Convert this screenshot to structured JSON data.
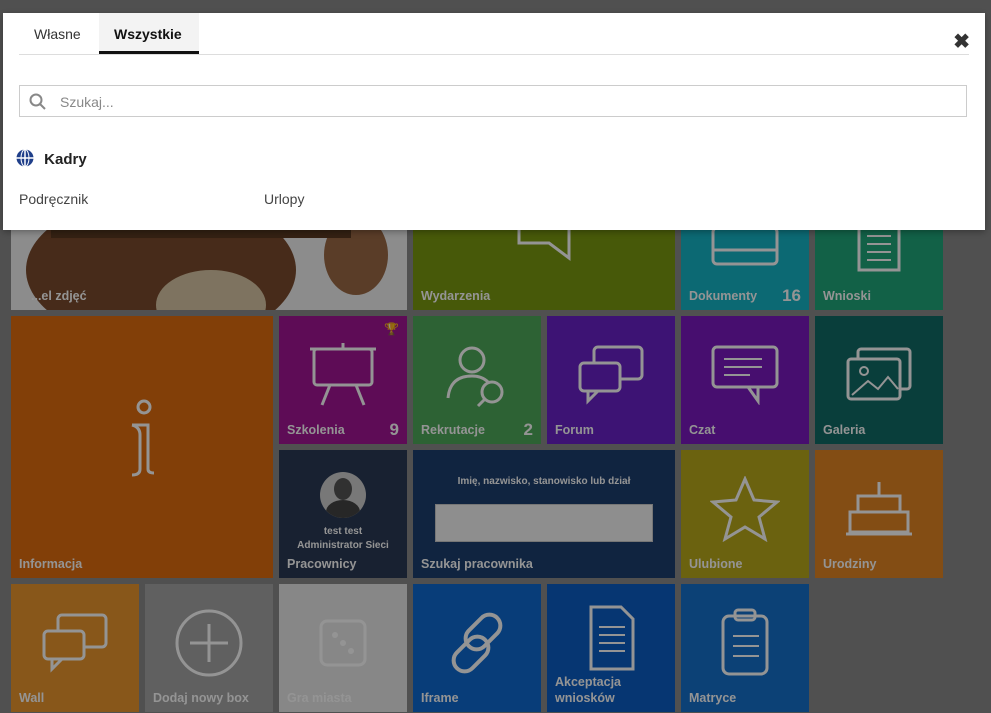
{
  "tiles": {
    "gallery": "...el zdjęć",
    "events": "Wydarzenia",
    "documents": "Dokumenty",
    "documents_count": "16",
    "requests": "Wnioski",
    "info": "Informacja",
    "trainings": "Szkolenia",
    "trainings_count": "9",
    "recruitment": "Rekrutacje",
    "recruitment_count": "2",
    "forum": "Forum",
    "chat": "Czat",
    "gallery2": "Galeria",
    "employees": "Pracownicy",
    "employee_name": "test test",
    "employee_role": "Administrator Sieci",
    "find_employee": "Szukaj pracownika",
    "find_employee_hint": "Imię, nazwisko, stanowisko lub dział",
    "favorites": "Ulubione",
    "birthdays": "Urodziny",
    "wall": "Wall",
    "add_box": "Dodaj nowy box",
    "city_game": "Gra miasta",
    "iframe": "Iframe",
    "approval_line1": "Akceptacja",
    "approval_line2": "wniosków",
    "matrices": "Matryce"
  },
  "colors": {
    "events": "#7b9a10",
    "documents": "#16b5c7",
    "requests": "#1fa77b",
    "info": "#e16d0e",
    "trainings": "#a21595",
    "recruitment": "#4fa95a",
    "forum": "#6a22c8",
    "chat": "#7a19c0",
    "gallery2": "#116b66",
    "employees": "#2a3a55",
    "find": "#1d3f6f",
    "favorites": "#b9a91b",
    "birthdays": "#e28523",
    "wall": "#ea962e",
    "add": "#a6a6a6",
    "iframe": "#0e6ad0",
    "approval": "#0c5ec4",
    "matrices": "#1570cc"
  },
  "modal": {
    "tabs": [
      "Własne",
      "Wszystkie"
    ],
    "active_tab": "Wszystkie",
    "close_icon": "close-icon",
    "search_placeholder": "Szukaj...",
    "section_title": "Kadry",
    "section_icon": "globe-icon",
    "links": [
      "Podręcznik",
      "Urlopy"
    ]
  }
}
